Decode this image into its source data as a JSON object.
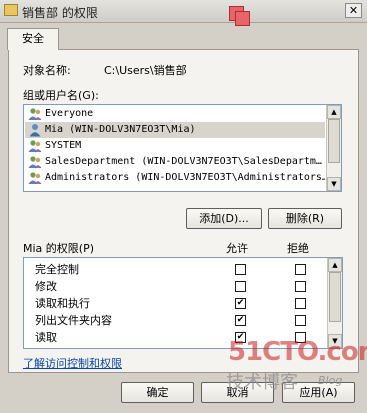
{
  "window": {
    "title": "销售部 的权限",
    "close_glyph": "✕"
  },
  "tab": {
    "label": "安全"
  },
  "object": {
    "label": "对象名称:",
    "value": "C:\\Users\\销售部"
  },
  "groups": {
    "label": "组或用户名(G):",
    "items": [
      {
        "name": "Everyone",
        "selected": false
      },
      {
        "name": "Mia (WIN-DOLV3N7EO3T\\Mia)",
        "selected": true
      },
      {
        "name": "SYSTEM",
        "selected": false
      },
      {
        "name": "SalesDepartment (WIN-DOLV3N7EO3T\\SalesDepartm…",
        "selected": false
      },
      {
        "name": "Administrators (WIN-DOLV3N7EO3T\\Administrators…",
        "selected": false
      }
    ]
  },
  "buttons": {
    "add": "添加(D)...",
    "remove": "删除(R)"
  },
  "permissions": {
    "label": "Mia 的权限(P)",
    "allow_header": "允许",
    "deny_header": "拒绝",
    "rows": [
      {
        "name": "完全控制",
        "allow": false,
        "deny": false
      },
      {
        "name": "修改",
        "allow": false,
        "deny": false
      },
      {
        "name": "读取和执行",
        "allow": true,
        "deny": false
      },
      {
        "name": "列出文件夹内容",
        "allow": true,
        "deny": false
      },
      {
        "name": "读取",
        "allow": true,
        "deny": false
      }
    ]
  },
  "link": {
    "text": "了解访问控制和权限"
  },
  "footer": {
    "ok": "确定",
    "cancel": "取消",
    "apply": "应用(A)"
  },
  "watermark": {
    "site": "51CTO.com",
    "sub": "技术博客",
    "blog": "Blog"
  },
  "colors": {
    "accent_link": "#0645ad",
    "watermark_red": "#c81e1e"
  },
  "icons": {
    "user": "user-icon",
    "check": "✔"
  }
}
